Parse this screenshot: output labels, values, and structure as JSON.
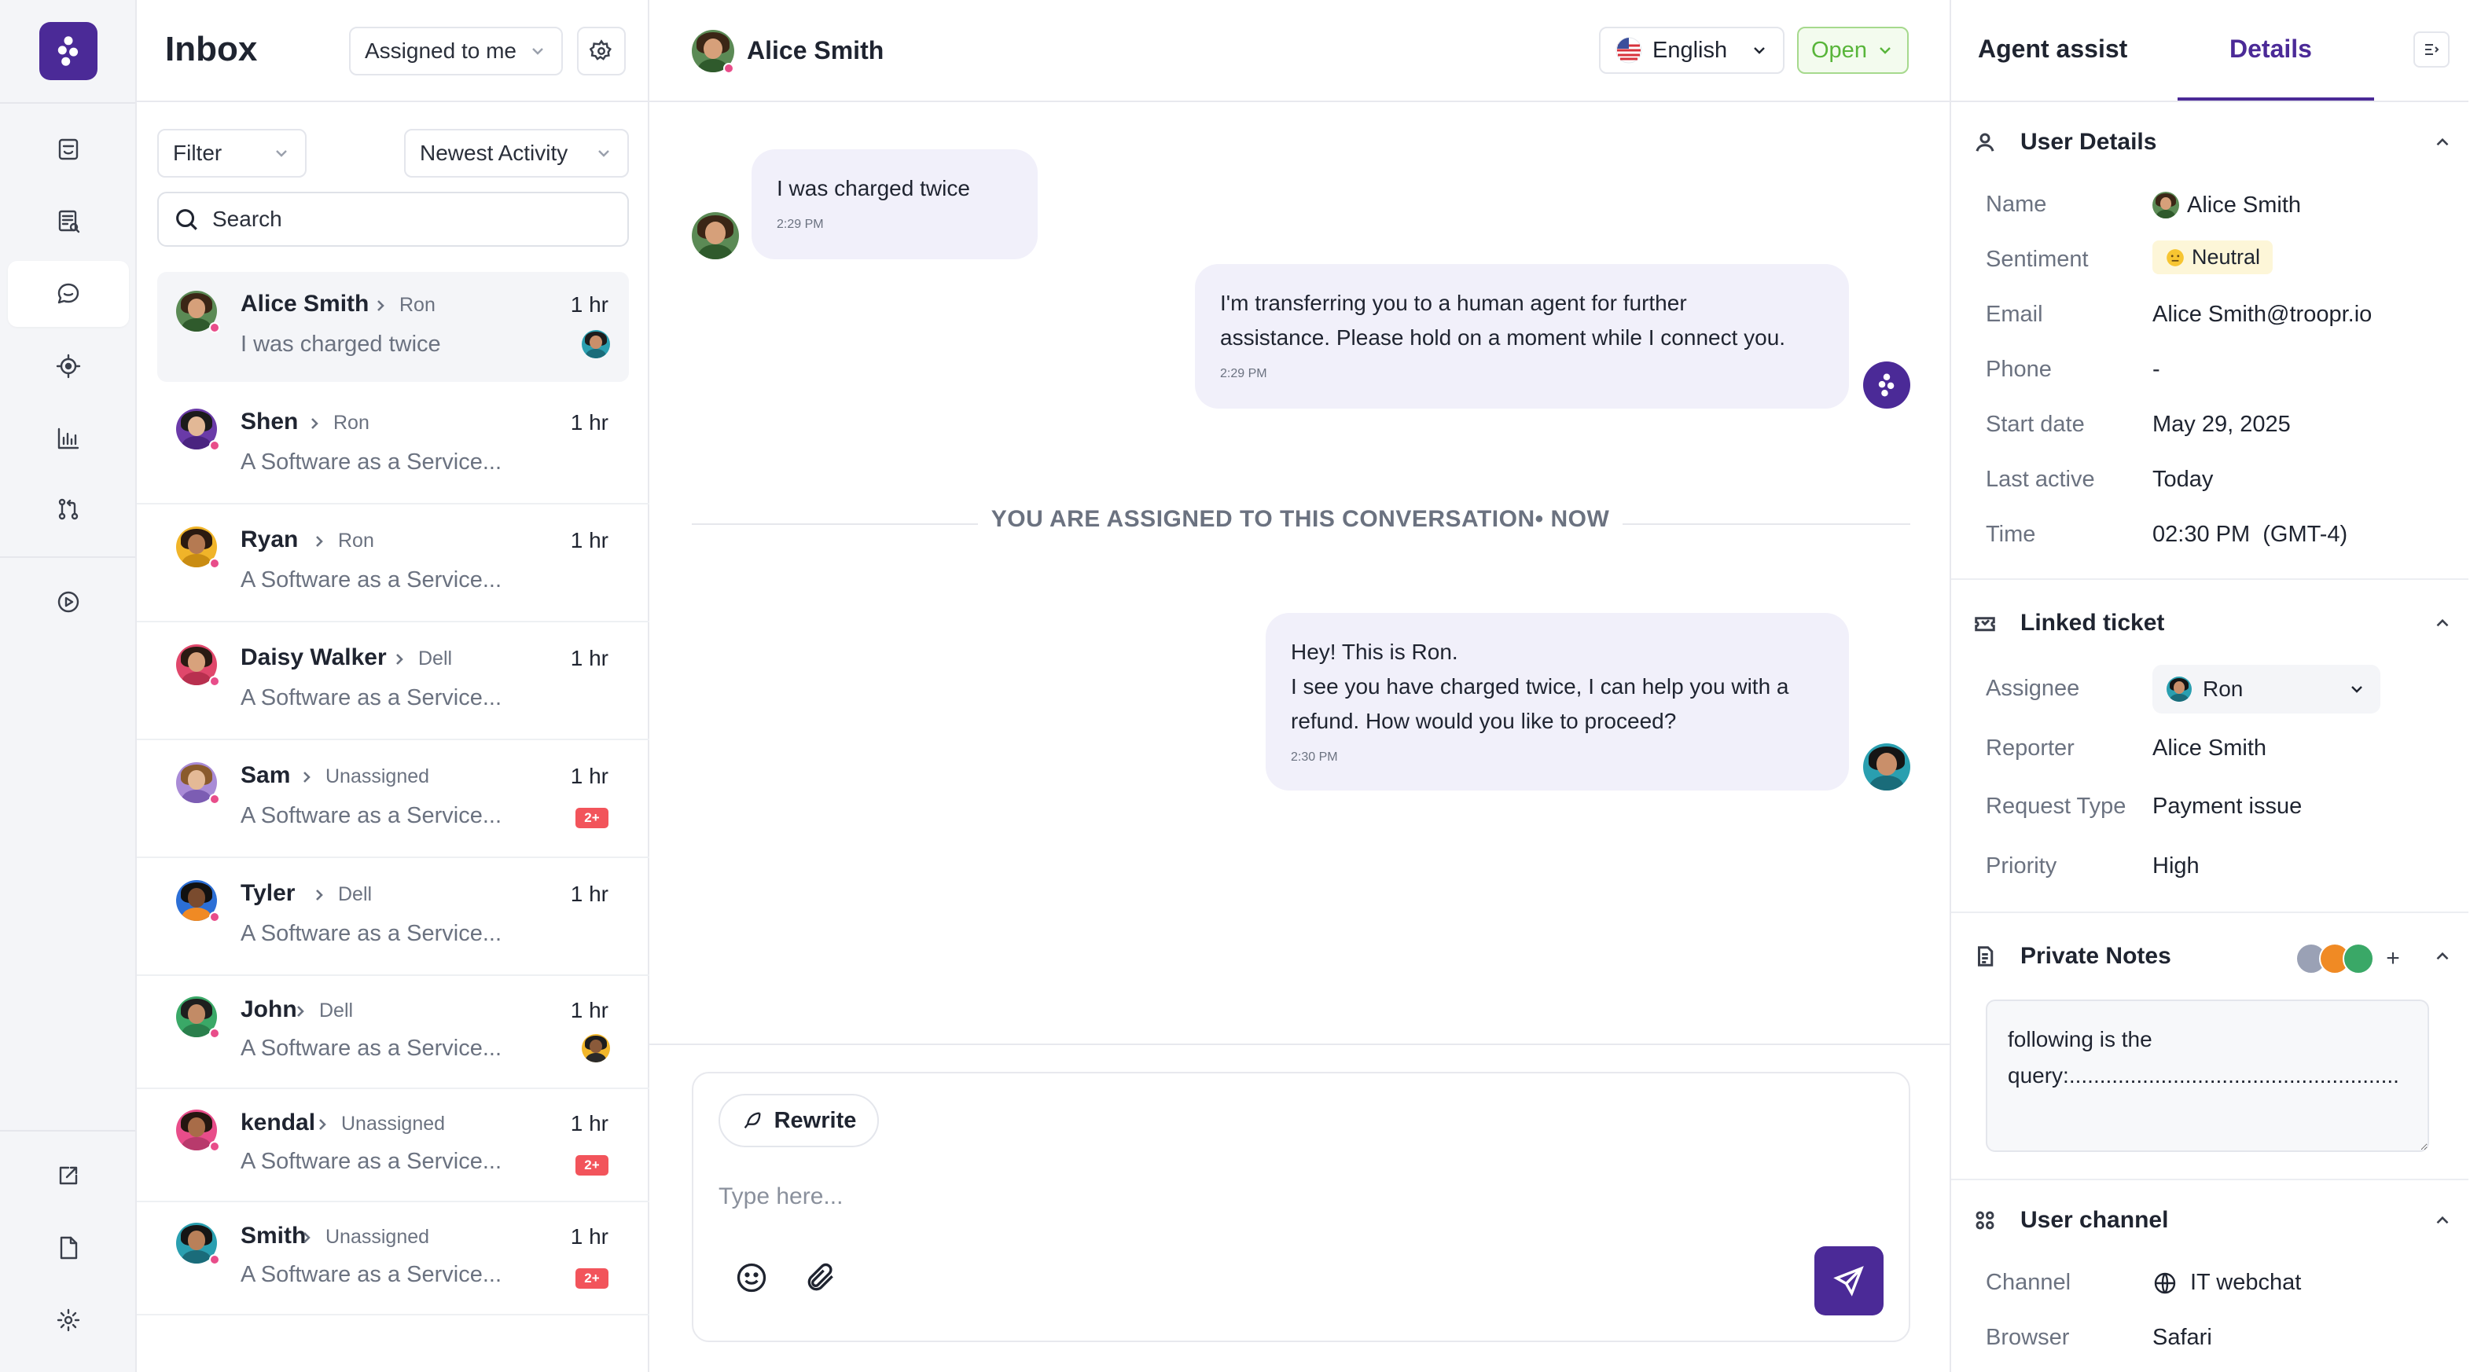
{
  "rail": {
    "items": [
      "dashboard",
      "reports",
      "inbox",
      "targets",
      "analytics",
      "workflows",
      "play"
    ],
    "bottom_items": [
      "launch",
      "docs",
      "settings"
    ]
  },
  "inbox": {
    "title": "Inbox",
    "assigned_filter": "Assigned to me",
    "filter_label": "Filter",
    "sort_label": "Newest Activity",
    "search_placeholder": "Search",
    "conversations": [
      {
        "name": "Alice Smith",
        "assignee": "Ron",
        "time": "1 hr",
        "preview": "I was charged twice",
        "indicator": "avatar"
      },
      {
        "name": "Shen",
        "assignee": "Ron",
        "time": "1 hr",
        "preview": "A Software as a Service...",
        "indicator": ""
      },
      {
        "name": "Ryan",
        "assignee": "Ron",
        "time": "1 hr",
        "preview": "A Software as a Service...",
        "indicator": ""
      },
      {
        "name": "Daisy Walker",
        "assignee": "Dell",
        "time": "1 hr",
        "preview": "A Software as a Service...",
        "indicator": ""
      },
      {
        "name": "Sam",
        "assignee": "Unassigned",
        "time": "1 hr",
        "preview": "A Software as a Service...",
        "indicator": "2+"
      },
      {
        "name": "Tyler",
        "assignee": "Dell",
        "time": "1 hr",
        "preview": "A Software as a Service...",
        "indicator": ""
      },
      {
        "name": "John",
        "assignee": "Dell",
        "time": "1 hr",
        "preview": "A Software as a Service...",
        "indicator": "avatar"
      },
      {
        "name": "kendal",
        "assignee": "Unassigned",
        "time": "1 hr",
        "preview": "A Software as a Service...",
        "indicator": "2+"
      },
      {
        "name": "Smith",
        "assignee": "Unassigned",
        "time": "1 hr",
        "preview": "A Software as a Service...",
        "indicator": "2+"
      }
    ]
  },
  "chat": {
    "contact_name": "Alice Smith",
    "language": "English",
    "status": "Open",
    "messages": [
      {
        "from": "user",
        "text": "I was charged twice",
        "time": "2:29 PM"
      },
      {
        "from": "bot",
        "text_lines": [
          "I'm transferring you to a human agent for further",
          "assistance. Please hold on a moment while I connect you."
        ],
        "time": "2:29 PM"
      },
      {
        "from": "agent",
        "text_lines": [
          "Hey! This is Ron.",
          "I see you have charged twice, I can help you with a",
          "refund. How would you like to proceed?"
        ],
        "time": "2:30 PM"
      }
    ],
    "assigned_notice": "YOU ARE ASSIGNED TO THIS CONVERSATION• NOW",
    "composer": {
      "rewrite_label": "Rewrite",
      "placeholder": "Type here..."
    }
  },
  "details": {
    "tabs": [
      "Agent assist",
      "Details"
    ],
    "active_tab": "Details",
    "user_details": {
      "title": "User Details",
      "fields": [
        {
          "label": "Name",
          "value": "Alice Smith"
        },
        {
          "label": "Sentiment",
          "value": "Neutral"
        },
        {
          "label": "Email",
          "value": "Alice Smith@troopr.io"
        },
        {
          "label": "Phone",
          "value": "-"
        },
        {
          "label": "Start date",
          "value": "May 29, 2025"
        },
        {
          "label": "Last active",
          "value": "Today"
        },
        {
          "label": "Time",
          "value": "02:30 PM  (GMT-4)"
        }
      ]
    },
    "linked_ticket": {
      "title": "Linked ticket",
      "assignee_label": "Assignee",
      "assignee": "Ron",
      "fields": [
        {
          "label": "Reporter",
          "value": "Alice Smith"
        },
        {
          "label": "Request Type",
          "value": "Payment issue"
        },
        {
          "label": "Priority",
          "value": "High"
        }
      ]
    },
    "private_notes": {
      "title": "Private Notes",
      "add_label": "+",
      "text": "following is the query:......................................................"
    },
    "user_channel": {
      "title": "User channel",
      "fields": [
        {
          "label": "Channel",
          "value": "IT webchat"
        },
        {
          "label": "Browser",
          "value": "Safari"
        }
      ]
    }
  },
  "colors": {
    "brand": "#4b2a97",
    "open_green": "#58b53a",
    "badge_red": "#f2545b",
    "bubble": "#f1f0fa",
    "status_pink": "#e84d8a"
  }
}
